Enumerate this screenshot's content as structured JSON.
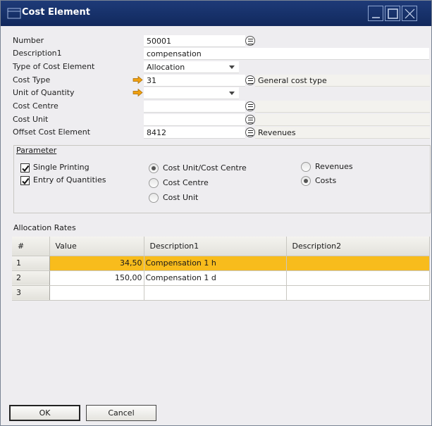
{
  "window": {
    "title": "Cost Element"
  },
  "fields": {
    "number": {
      "label": "Number",
      "value": "50001"
    },
    "description1": {
      "label": "Description1",
      "value": "compensation"
    },
    "type_of_cost_element": {
      "label": "Type of Cost Element",
      "value": "Allocation"
    },
    "cost_type": {
      "label": "Cost Type",
      "value": "31",
      "description": "General cost type"
    },
    "unit_of_quantity": {
      "label": "Unit of Quantity",
      "value": ""
    },
    "cost_centre": {
      "label": "Cost Centre",
      "value": "",
      "description": ""
    },
    "cost_unit": {
      "label": "Cost Unit",
      "value": "",
      "description": ""
    },
    "offset_cost_element": {
      "label": "Offset Cost Element",
      "value": "8412",
      "description": "Revenues"
    }
  },
  "parameter": {
    "title": "Parameter",
    "single_printing": {
      "label": "Single Printing",
      "checked": true
    },
    "entry_of_quantities": {
      "label": "Entry of Quantities",
      "checked": true
    },
    "cost_unit_cost_centre": {
      "label": "Cost Unit/Cost Centre",
      "selected": true
    },
    "cost_centre": {
      "label": "Cost Centre",
      "selected": false
    },
    "cost_unit": {
      "label": "Cost Unit",
      "selected": false
    },
    "revenues": {
      "label": "Revenues",
      "selected": false
    },
    "costs": {
      "label": "Costs",
      "selected": true
    }
  },
  "allocation_rates": {
    "title": "Allocation Rates",
    "columns": [
      "#",
      "Value",
      "Description1",
      "Description2"
    ],
    "rows": [
      {
        "num": "1",
        "value": "34,50",
        "desc1": "Compensation 1 h",
        "desc2": ""
      },
      {
        "num": "2",
        "value": "150,00",
        "desc1": "Compensation 1 d",
        "desc2": ""
      },
      {
        "num": "3",
        "value": "",
        "desc1": "",
        "desc2": ""
      }
    ]
  },
  "buttons": {
    "ok": "OK",
    "cancel": "Cancel"
  },
  "colors": {
    "titlebar": "#163068",
    "selected_row": "#f8bc1c",
    "link_arrow": "#f0a010"
  }
}
